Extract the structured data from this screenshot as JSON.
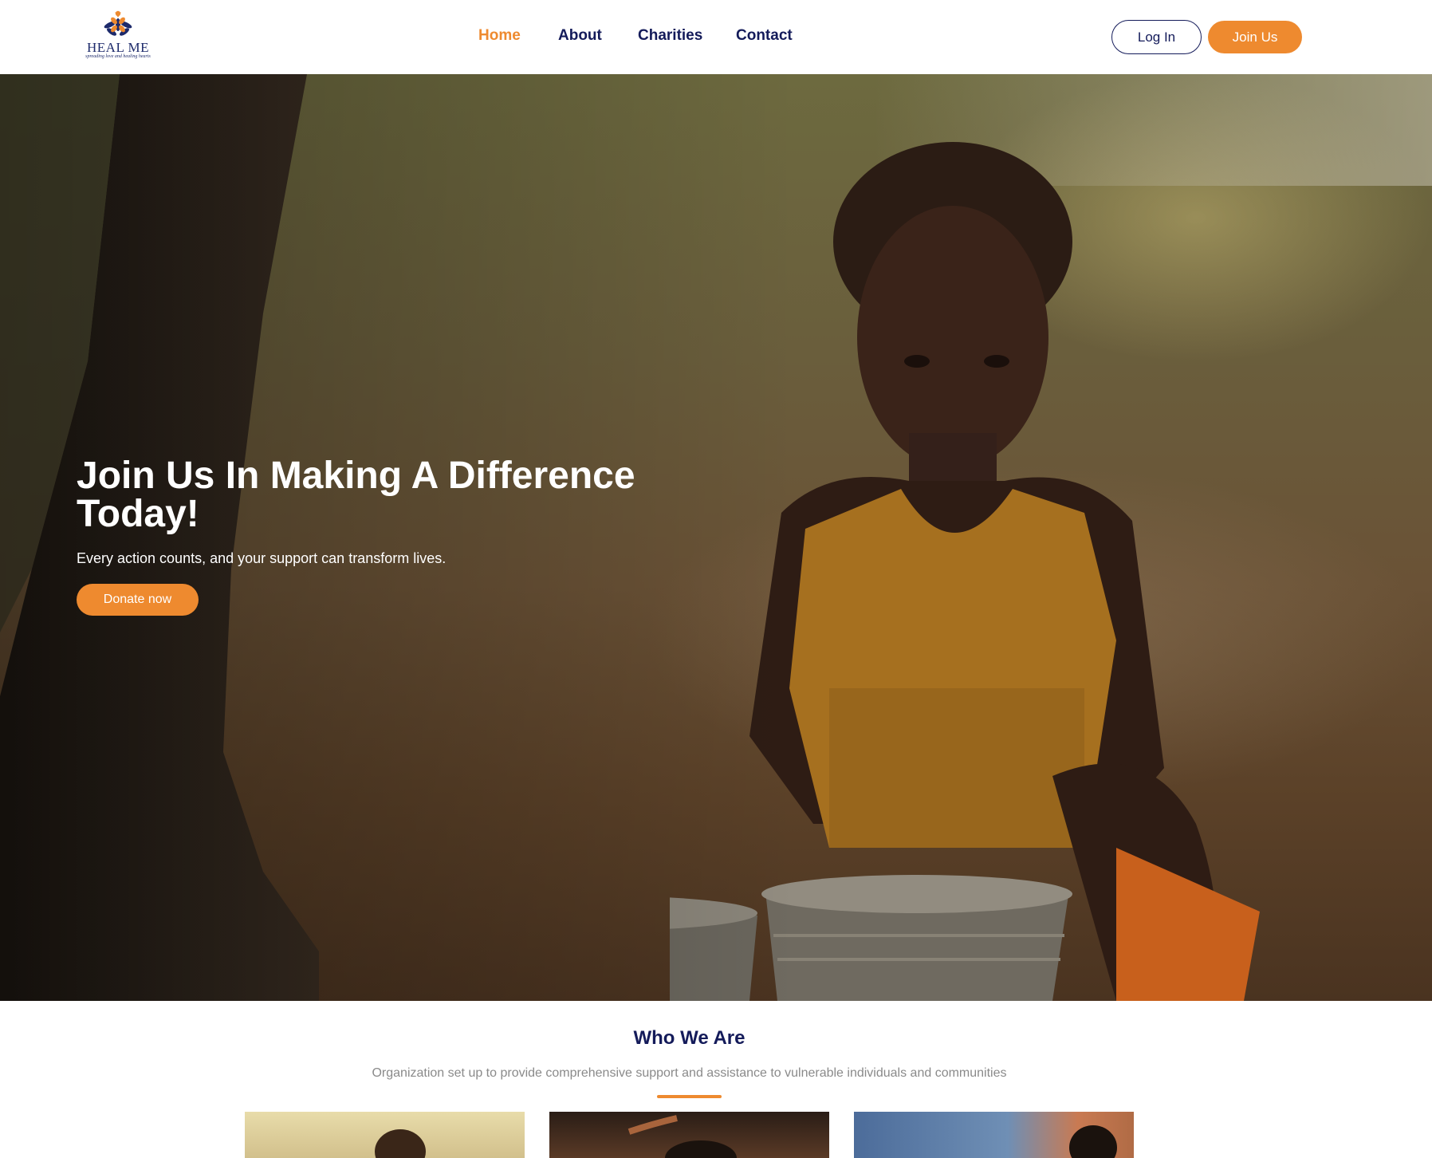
{
  "brand": {
    "name": "HEAL ME",
    "tagline": "spreading love and healing hearts",
    "colors": {
      "primary": "#141b5a",
      "accent": "#ee8a2f"
    }
  },
  "nav": {
    "items": [
      {
        "label": "Home",
        "active": true
      },
      {
        "label": "About",
        "active": false
      },
      {
        "label": "Charities",
        "active": false
      },
      {
        "label": "Contact",
        "active": false
      }
    ]
  },
  "auth": {
    "login_label": "Log In",
    "join_label": "Join Us"
  },
  "hero": {
    "title": "Join Us In Making A Difference Today!",
    "subtitle": "Every action counts, and your support can transform lives.",
    "cta_label": "Donate now",
    "image": "child-with-buckets-photo"
  },
  "who_we_are": {
    "title": "Who We Are",
    "description": "Organization set up to provide comprehensive support and assistance to vulnerable individuals and communities",
    "cards": [
      {
        "image": "child-photo-1"
      },
      {
        "image": "child-photo-2"
      },
      {
        "image": "child-photo-3"
      }
    ]
  }
}
